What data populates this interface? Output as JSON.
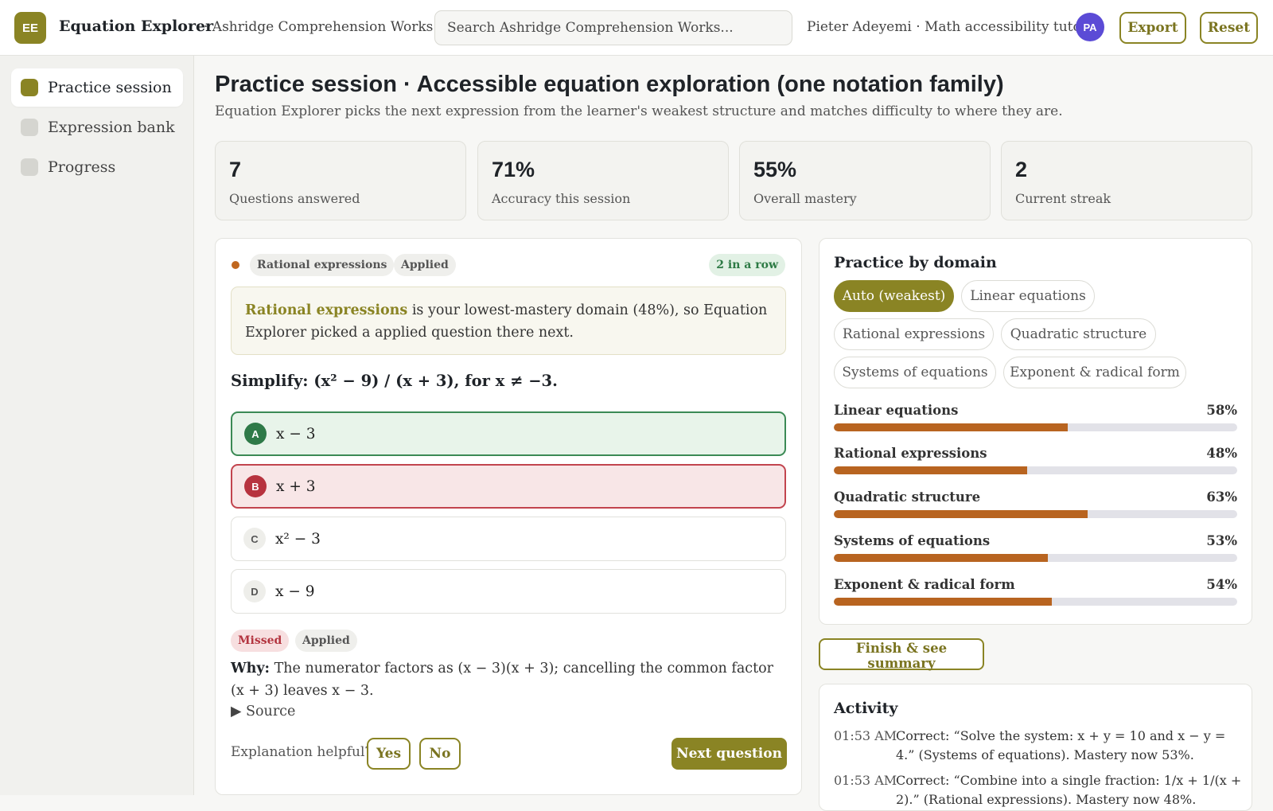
{
  "app": {
    "logo": "EE",
    "name": "Equation Explorer",
    "org": "· Ashridge Comprehension Works",
    "search_placeholder": "Search Ashridge Comprehension Works...",
    "user": "Pieter Adeyemi · Math accessibility tutor",
    "avatar": "PA",
    "export_label": "Export",
    "reset_label": "Reset"
  },
  "sidebar": {
    "items": [
      {
        "label": "Practice session",
        "active": true
      },
      {
        "label": "Expression bank",
        "active": false
      },
      {
        "label": "Progress",
        "active": false
      }
    ]
  },
  "header": {
    "title": "Practice session · Accessible equation exploration (one notation family)",
    "subtitle": "Equation Explorer picks the next expression from the learner's weakest structure and matches difficulty to where they are."
  },
  "stats": [
    {
      "value": "7",
      "label": "Questions answered"
    },
    {
      "value": "71%",
      "label": "Accuracy this session"
    },
    {
      "value": "55%",
      "label": "Overall mastery"
    },
    {
      "value": "2",
      "label": "Current streak"
    }
  ],
  "question": {
    "domain_tag": "Rational expressions",
    "level_tag": "Applied",
    "streak_tag": "2 in a row",
    "hint_domain": "Rational expressions",
    "hint_rest": " is your lowest-mastery domain (48%), so Equation Explorer picked a applied question there next.",
    "prompt": "Simplify: (x² − 9) / (x + 3), for x ≠ −3.",
    "options": [
      {
        "letter": "A",
        "text": "x − 3",
        "state": "correct"
      },
      {
        "letter": "B",
        "text": "x + 3",
        "state": "wrong"
      },
      {
        "letter": "C",
        "text": "x² − 3",
        "state": "neutral"
      },
      {
        "letter": "D",
        "text": "x − 9",
        "state": "neutral"
      }
    ],
    "result_tag": "Missed",
    "result_level": "Applied",
    "why_label": "Why:",
    "why_text": " The numerator factors as (x − 3)(x + 3); cancelling the common factor (x + 3) leaves x − 3.",
    "source_label": "▶ Source",
    "helpful_label": "Explanation helpful?",
    "yes_label": "Yes",
    "no_label": "No",
    "next_label": "Next question"
  },
  "domains": {
    "title": "Practice by domain",
    "chips": [
      {
        "label": "Auto (weakest)",
        "active": true
      },
      {
        "label": "Linear equations",
        "active": false
      },
      {
        "label": "Rational expressions",
        "active": false
      },
      {
        "label": "Quadratic structure",
        "active": false
      },
      {
        "label": "Systems of equations",
        "active": false
      },
      {
        "label": "Exponent & radical form",
        "active": false
      }
    ],
    "mastery": [
      {
        "name": "Linear equations",
        "pct": 58,
        "pct_label": "58%"
      },
      {
        "name": "Rational expressions",
        "pct": 48,
        "pct_label": "48%"
      },
      {
        "name": "Quadratic structure",
        "pct": 63,
        "pct_label": "63%"
      },
      {
        "name": "Systems of equations",
        "pct": 53,
        "pct_label": "53%"
      },
      {
        "name": "Exponent & radical form",
        "pct": 54,
        "pct_label": "54%"
      }
    ],
    "bar_color": "#b86420",
    "accent": "#8a8424"
  },
  "finish_label": "Finish & see summary",
  "activity": {
    "title": "Activity",
    "items": [
      {
        "time": "01:53 AM",
        "text": "Correct: “Solve the system: x + y = 10 and x − y = 4.” (Systems of equations). Mastery now 53%."
      },
      {
        "time": "01:53 AM",
        "text": "Correct: “Combine into a single fraction: 1/x + 1/(x + 2).” (Rational expressions). Mastery now 48%."
      }
    ]
  }
}
